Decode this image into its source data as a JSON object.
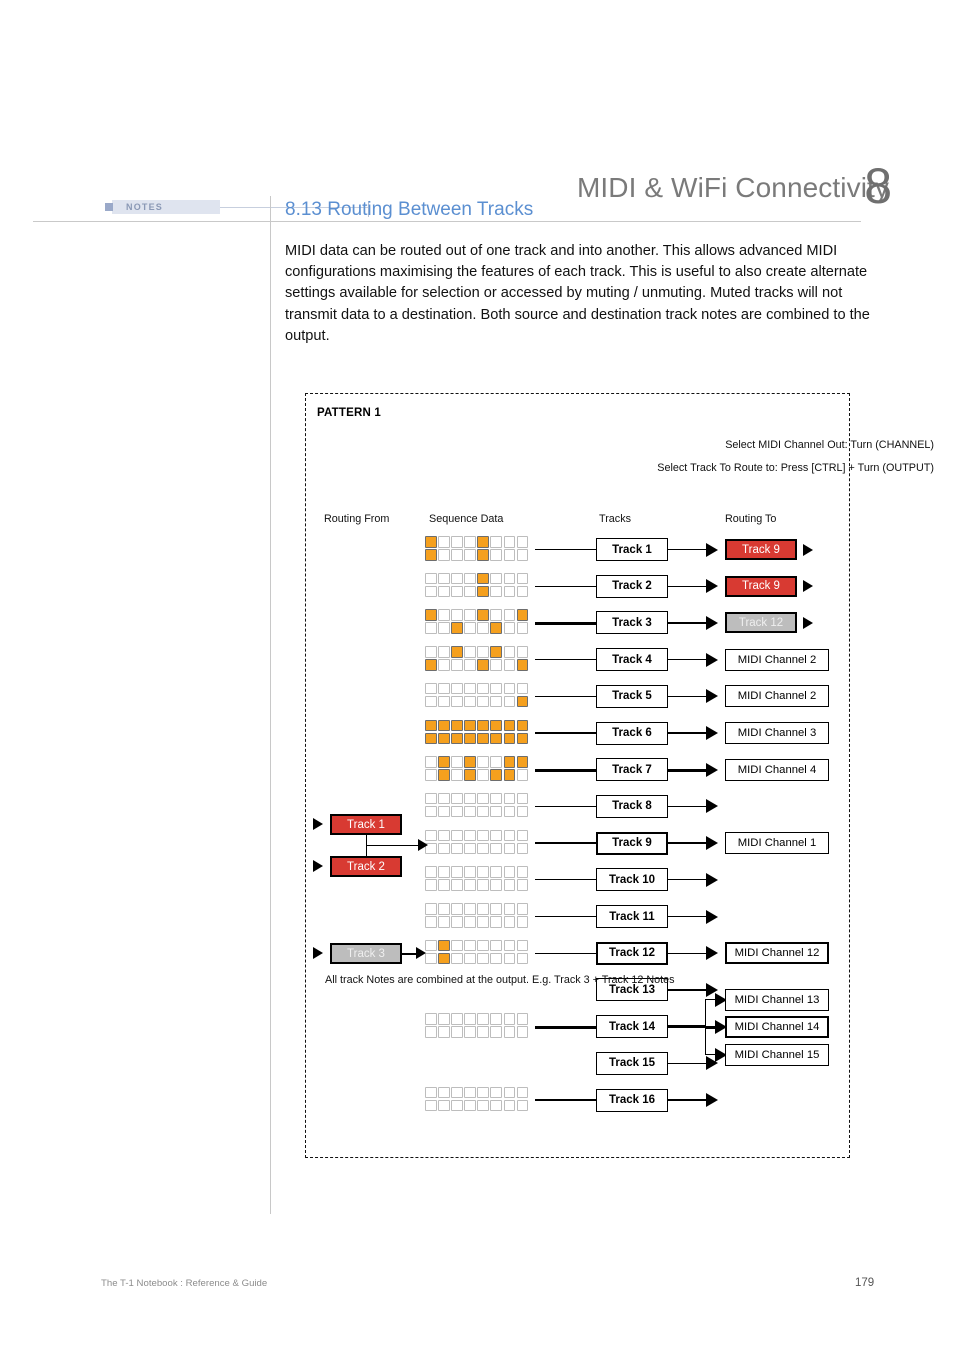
{
  "header": {
    "title": "MIDI & WiFi Connectivity",
    "chapter_number": "8"
  },
  "notes": {
    "label": "NOTES"
  },
  "section": {
    "title": "8.13 Routing Between Tracks",
    "body": "MIDI data can be routed out of one track and into another. This allows advanced MIDI configurations maximising the features of each track. This is useful to also create alternate settings available for selection or accessed by muting / unmuting. Muted tracks will not transmit data to a destination. Both source and destination track notes are combined to the output."
  },
  "diagram": {
    "pattern_label": "PATTERN 1",
    "hint_channel": "Select MIDI Channel Out: Turn (CHANNEL)",
    "hint_track": "Select Track To Route to: Press [CTRL] + Turn (OUTPUT)",
    "columns": {
      "routing_from": "Routing From",
      "sequence_data": "Sequence Data",
      "tracks": "Tracks",
      "routing_to": "Routing To"
    },
    "combine_note": "All track Notes are combined at the output.\nE.g. Track 3 + Track 12 Notes",
    "colors": {
      "step_on": "#f5a01e",
      "step_off": "#ffffff",
      "highlight_red": "#d83a32",
      "muted_grey": "#bdbdbd",
      "accent_blue": "#5b8fd1"
    },
    "routing_from": [
      {
        "label": "Track 1",
        "state": "red"
      },
      {
        "label": "Track 2",
        "state": "red"
      },
      {
        "label": "Track 3",
        "state": "grey"
      }
    ],
    "tracks": [
      {
        "label": "Track 1",
        "steps_top": [
          1,
          0,
          0,
          0,
          1,
          0,
          0,
          0
        ],
        "steps_bottom": [
          1,
          0,
          0,
          0,
          1,
          0,
          0,
          0
        ],
        "has_grid": true,
        "bold_line": false,
        "destination": "Track 9",
        "dest_type": "routed-red"
      },
      {
        "label": "Track 2",
        "steps_top": [
          0,
          0,
          0,
          0,
          1,
          0,
          0,
          0
        ],
        "steps_bottom": [
          0,
          0,
          0,
          0,
          1,
          0,
          0,
          0
        ],
        "has_grid": true,
        "bold_line": false,
        "destination": "Track 9",
        "dest_type": "routed-red"
      },
      {
        "label": "Track 3",
        "steps_top": [
          1,
          0,
          0,
          0,
          1,
          0,
          0,
          1
        ],
        "steps_bottom": [
          0,
          0,
          1,
          0,
          0,
          1,
          0,
          0
        ],
        "has_grid": true,
        "bold_line": true,
        "destination": "Track 12",
        "dest_type": "routed-grey"
      },
      {
        "label": "Track 4",
        "steps_top": [
          0,
          0,
          1,
          0,
          0,
          1,
          0,
          0
        ],
        "steps_bottom": [
          1,
          0,
          0,
          0,
          1,
          0,
          0,
          1
        ],
        "has_grid": true,
        "bold_line": false,
        "destination": "MIDI Channel 2",
        "dest_type": "midi"
      },
      {
        "label": "Track 5",
        "steps_top": [
          0,
          0,
          0,
          0,
          0,
          0,
          0,
          0
        ],
        "steps_bottom": [
          0,
          0,
          0,
          0,
          0,
          0,
          0,
          1
        ],
        "has_grid": true,
        "bold_line": false,
        "destination": "MIDI Channel 2",
        "dest_type": "midi"
      },
      {
        "label": "Track 6",
        "steps_top": [
          1,
          1,
          1,
          1,
          1,
          1,
          1,
          1
        ],
        "steps_bottom": [
          1,
          1,
          1,
          1,
          1,
          1,
          1,
          1
        ],
        "has_grid": true,
        "bold_line": false,
        "destination": "MIDI Channel 3",
        "dest_type": "midi"
      },
      {
        "label": "Track 7",
        "steps_top": [
          0,
          1,
          0,
          1,
          0,
          0,
          1,
          1
        ],
        "steps_bottom": [
          0,
          1,
          0,
          1,
          0,
          1,
          1,
          0
        ],
        "has_grid": true,
        "bold_line": true,
        "destination": "MIDI Channel 4",
        "dest_type": "midi"
      },
      {
        "label": "Track 8",
        "steps_top": [
          0,
          0,
          0,
          0,
          0,
          0,
          0,
          0
        ],
        "steps_bottom": [
          0,
          0,
          0,
          0,
          0,
          0,
          0,
          0
        ],
        "has_grid": true,
        "bold_line": false,
        "destination": "",
        "dest_type": "none"
      },
      {
        "label": "Track 9",
        "steps_top": [
          0,
          0,
          0,
          0,
          0,
          0,
          0,
          0
        ],
        "steps_bottom": [
          0,
          0,
          0,
          0,
          0,
          0,
          0,
          0
        ],
        "has_grid": true,
        "bold_line": false,
        "destination": "MIDI Channel 1",
        "dest_type": "midi"
      },
      {
        "label": "Track 10",
        "steps_top": [
          0,
          0,
          0,
          0,
          0,
          0,
          0,
          0
        ],
        "steps_bottom": [
          0,
          0,
          0,
          0,
          0,
          0,
          0,
          0
        ],
        "has_grid": true,
        "bold_line": false,
        "destination": "",
        "dest_type": "none"
      },
      {
        "label": "Track 11",
        "steps_top": [
          0,
          0,
          0,
          0,
          0,
          0,
          0,
          0
        ],
        "steps_bottom": [
          0,
          0,
          0,
          0,
          0,
          0,
          0,
          0
        ],
        "has_grid": true,
        "bold_line": false,
        "destination": "",
        "dest_type": "none"
      },
      {
        "label": "Track 12",
        "steps_top": [
          0,
          1,
          0,
          0,
          0,
          0,
          0,
          0
        ],
        "steps_bottom": [
          0,
          1,
          0,
          0,
          0,
          0,
          0,
          0
        ],
        "has_grid": true,
        "bold_line": false,
        "destination": "MIDI Channel 12",
        "dest_type": "midi"
      },
      {
        "label": "Track 13",
        "steps_top": [],
        "steps_bottom": [],
        "has_grid": false,
        "bold_line": false,
        "destination": "",
        "dest_type": "none"
      },
      {
        "label": "Track 14",
        "steps_top": [
          0,
          0,
          0,
          0,
          0,
          0,
          0,
          0
        ],
        "steps_bottom": [
          0,
          0,
          0,
          0,
          0,
          0,
          0,
          0
        ],
        "has_grid": true,
        "bold_line": true,
        "destination": "MIDI Channel 14",
        "dest_type": "midi-fan"
      },
      {
        "label": "Track 15",
        "steps_top": [],
        "steps_bottom": [],
        "has_grid": false,
        "bold_line": false,
        "destination": "",
        "dest_type": "none"
      },
      {
        "label": "Track 16",
        "steps_top": [
          0,
          0,
          0,
          0,
          0,
          0,
          0,
          0
        ],
        "steps_bottom": [
          0,
          0,
          0,
          0,
          0,
          0,
          0,
          0
        ],
        "has_grid": true,
        "bold_line": false,
        "destination": "",
        "dest_type": "none"
      }
    ],
    "fan_out_channels": [
      "MIDI Channel 13",
      "MIDI Channel 14",
      "MIDI Channel 15"
    ]
  },
  "footer": {
    "left": "The T-1 Notebook : Reference & Guide",
    "page": "179"
  }
}
